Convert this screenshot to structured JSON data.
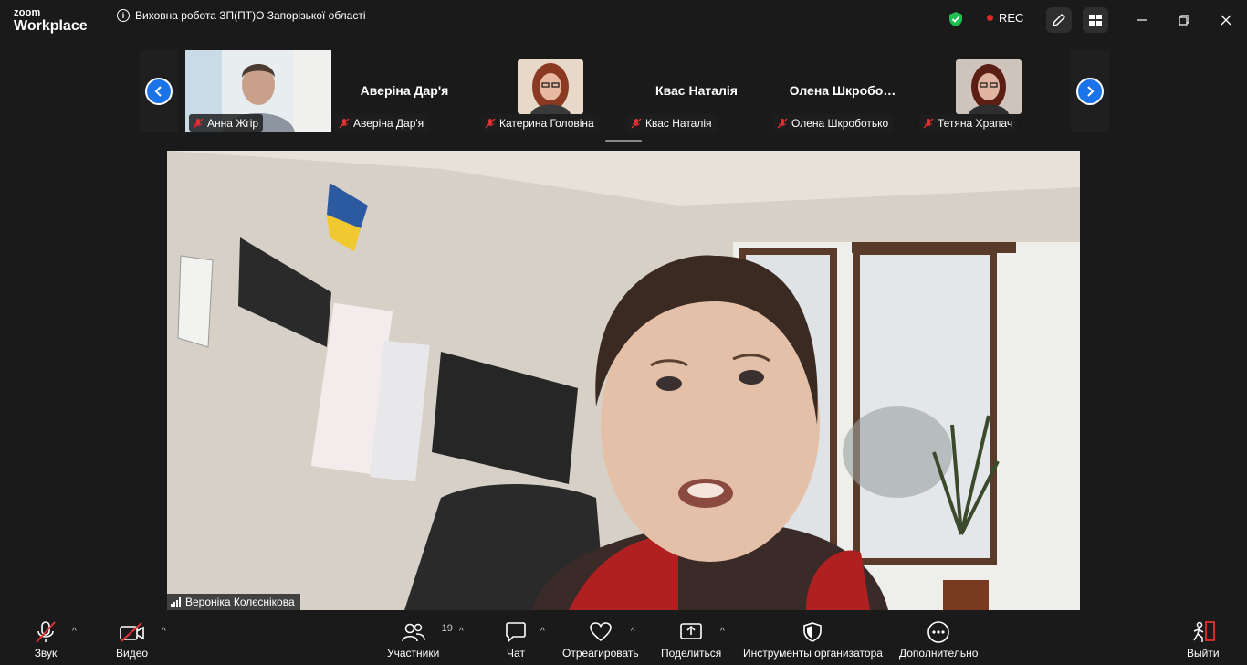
{
  "app": {
    "logo_line1": "zoom",
    "logo_line2": "Workplace"
  },
  "meeting": {
    "title": "Виховна робота ЗП(ПТ)О Запорізької області",
    "rec_label": "REC"
  },
  "colors": {
    "background": "#1a1a1a",
    "accent": "#1a73e8",
    "security": "#1fbf4f",
    "recording": "#e02828"
  },
  "participants_strip": [
    {
      "display": "video",
      "label": "Анна Жгір"
    },
    {
      "display": "name",
      "big_name": "Аверіна Дар'я",
      "label": "Аверіна Дар'я"
    },
    {
      "display": "avatar",
      "label": "Катерина Головіна"
    },
    {
      "display": "name",
      "big_name": "Квас Наталія",
      "label": "Квас Наталія"
    },
    {
      "display": "name",
      "big_name": "Олена  Шкробо…",
      "label": "Олена Шкроботько"
    },
    {
      "display": "avatar",
      "label": "Тетяна Храпач"
    }
  ],
  "active_speaker": {
    "name": "Вероніка Колєснікова"
  },
  "toolbar": {
    "audio_label": "Звук",
    "video_label": "Видео",
    "participants_label": "Участники",
    "participants_count": "19",
    "chat_label": "Чат",
    "react_label": "Отреагировать",
    "share_label": "Поделиться",
    "host_tools_label": "Инструменты организатора",
    "more_label": "Дополнительно",
    "leave_label": "Выйти"
  }
}
